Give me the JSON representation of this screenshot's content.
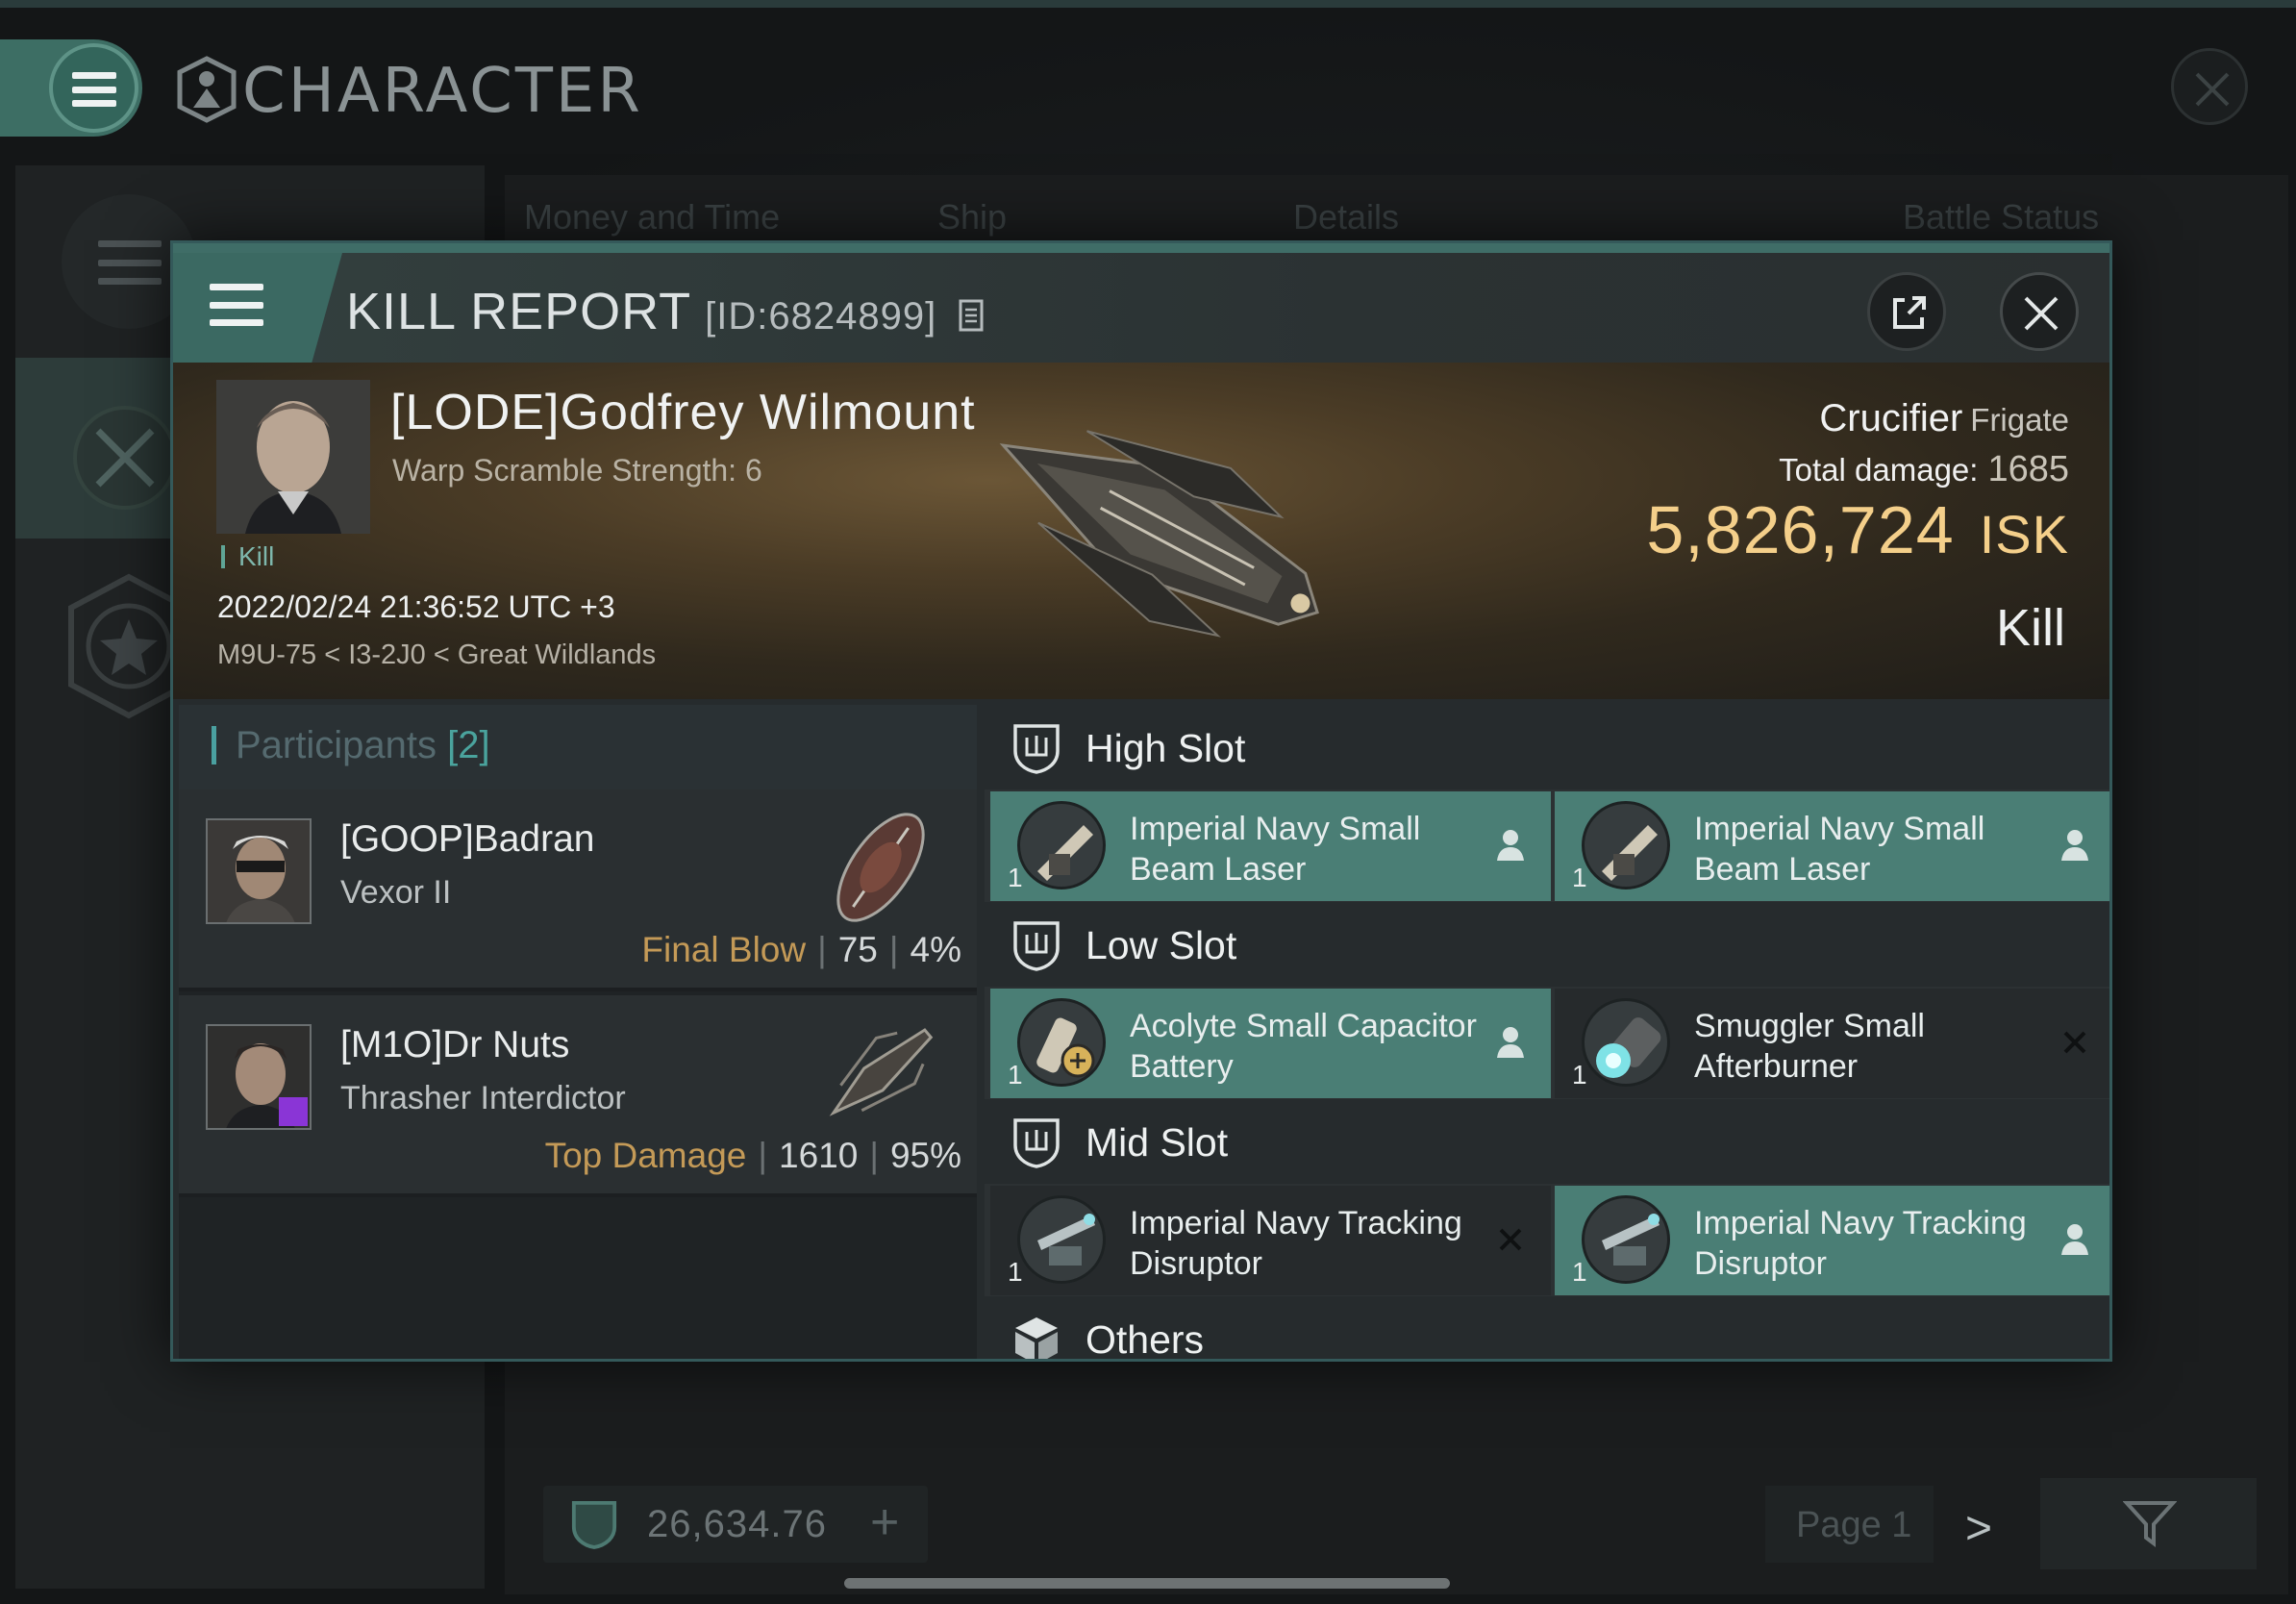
{
  "screen": {
    "title": "CHARACTER",
    "tabs": [
      "Money and Time",
      "Ship",
      "Details",
      "Battle Status"
    ],
    "wallet": {
      "value": "26,634.76"
    },
    "page_label": "Page 1"
  },
  "kill_report": {
    "title": "KILL REPORT",
    "id_label": "[ID:6824899]",
    "victim": {
      "name": "[LODE]Godfrey Wilmount",
      "warp_scramble": "Warp Scramble Strength: 6",
      "kill_tag": "Kill",
      "datetime": "2022/02/24 21:36:52 UTC +3",
      "location": "M9U-75 < I3-2J0 < Great Wildlands"
    },
    "ship": {
      "name": "Crucifier",
      "class": "Frigate",
      "total_damage_label": "Total damage:",
      "total_damage": "1685",
      "isk_value": "5,826,724",
      "isk_unit": "ISK",
      "result": "Kill"
    },
    "participants": {
      "label": "Participants",
      "count": "[2]",
      "rows": [
        {
          "name": "[GOOP]Badran",
          "ship": "Vexor II",
          "tag": "Final Blow",
          "damage": "75",
          "percent": "4%"
        },
        {
          "name": "[M1O]Dr Nuts",
          "ship": "Thrasher Interdictor",
          "tag": "Top Damage",
          "damage": "1610",
          "percent": "95%"
        }
      ]
    },
    "slots": [
      {
        "label": "High Slot",
        "modules": [
          {
            "name": "Imperial Navy Small Beam Laser",
            "qty": "1",
            "state": "dropped"
          },
          {
            "name": "Imperial Navy Small Beam Laser",
            "qty": "1",
            "state": "dropped"
          }
        ]
      },
      {
        "label": "Low Slot",
        "modules": [
          {
            "name": "Acolyte Small Capacitor Battery",
            "qty": "1",
            "state": "dropped"
          },
          {
            "name": "Smuggler Small Afterburner",
            "qty": "1",
            "state": "destroyed"
          }
        ]
      },
      {
        "label": "Mid Slot",
        "modules": [
          {
            "name": "Imperial Navy Tracking Disruptor",
            "qty": "1",
            "state": "destroyed"
          },
          {
            "name": "Imperial Navy Tracking Disruptor",
            "qty": "1",
            "state": "dropped"
          }
        ]
      },
      {
        "label": "Others",
        "modules": []
      }
    ]
  },
  "colors": {
    "accent": "#4a7e75",
    "isk": "#f4cf8a",
    "tag": "#c49a57",
    "purple_badge": "#8a35d6"
  },
  "icons": [
    "menu-icon",
    "character-icon",
    "close-icon",
    "external-link-icon",
    "copy-icon",
    "shield-slot-icon",
    "cube-icon",
    "person-icon",
    "x-mark-icon",
    "filter-icon",
    "plus-icon",
    "chevron-right-icon"
  ]
}
